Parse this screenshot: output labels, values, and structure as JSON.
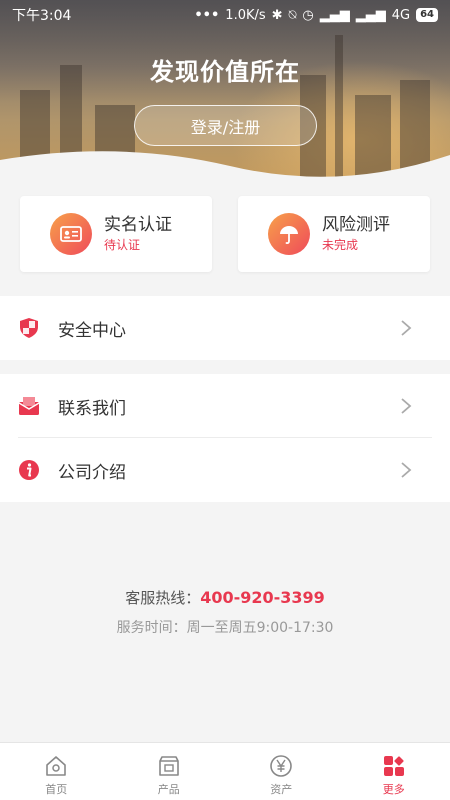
{
  "status_bar": {
    "time": "下午3:04",
    "net_speed": "1.0K/s",
    "network": "4G",
    "battery": "64"
  },
  "header": {
    "slogan": "发现价值所在",
    "login_label": "登录/注册"
  },
  "cards": [
    {
      "title": "实名认证",
      "status": "待认证",
      "icon": "id-card-icon"
    },
    {
      "title": "风险测评",
      "status": "未完成",
      "icon": "umbrella-icon"
    }
  ],
  "menu": {
    "security": {
      "label": "安全中心",
      "icon": "shield-icon"
    },
    "contact": {
      "label": "联系我们",
      "icon": "mail-icon"
    },
    "about": {
      "label": "公司介绍",
      "icon": "info-icon"
    }
  },
  "support": {
    "hotline_label": "客服热线：",
    "hotline_number": "400-920-3399",
    "hours": "服务时间：周一至周五9:00-17:30"
  },
  "tabs": [
    {
      "label": "首页",
      "icon": "home-icon"
    },
    {
      "label": "产品",
      "icon": "product-box-icon"
    },
    {
      "label": "资产",
      "icon": "yen-coin-icon"
    },
    {
      "label": "更多",
      "icon": "more-grid-icon"
    }
  ],
  "colors": {
    "accent": "#e8384f",
    "gradient_start": "#f7a14a",
    "gradient_end": "#ef4a5a"
  }
}
